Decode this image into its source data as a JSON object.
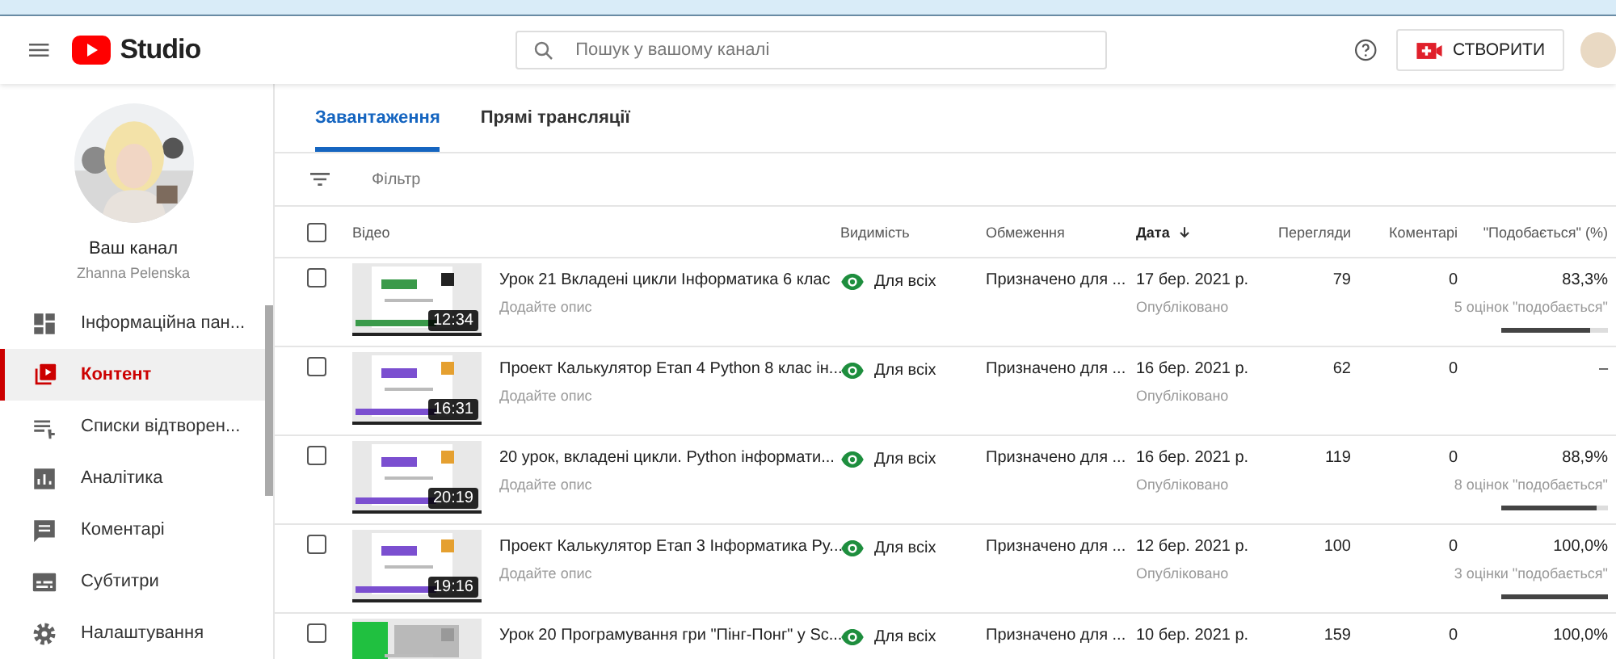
{
  "header": {
    "logo_text": "Studio",
    "search": {
      "placeholder": "Пошук у вашому каналі"
    },
    "create_button": "СТВОРИТИ"
  },
  "sidebar": {
    "channel_title": "Ваш канал",
    "channel_name": "Zhanna Pelenska",
    "items": [
      {
        "label": "Інформаційна пан...",
        "selected": false
      },
      {
        "label": "Контент",
        "selected": true
      },
      {
        "label": "Списки відтворен...",
        "selected": false
      },
      {
        "label": "Аналітика",
        "selected": false
      },
      {
        "label": "Коментарі",
        "selected": false
      },
      {
        "label": "Субтитри",
        "selected": false
      },
      {
        "label": "Налаштування",
        "selected": false
      }
    ]
  },
  "tabs": [
    {
      "label": "Завантаження",
      "selected": true
    },
    {
      "label": "Прямі трансляції",
      "selected": false
    }
  ],
  "filter": {
    "placeholder": "Фільтр"
  },
  "table": {
    "select_all_checked": false,
    "columns": [
      {
        "label": "Відео",
        "sorted": false
      },
      {
        "label": "Видимість",
        "sorted": false
      },
      {
        "label": "Обмеження",
        "sorted": false
      },
      {
        "label": "Дата",
        "sorted": true
      },
      {
        "label": "Перегляди",
        "sorted": false
      },
      {
        "label": "Коментарі",
        "sorted": false
      },
      {
        "label": "\"Подобається\" (%)",
        "sorted": false
      }
    ],
    "rows": [
      {
        "checked": false,
        "duration": "12:34",
        "title": "Урок 21 Вкладені цикли Інформатика 6 клас",
        "description": "Додайте опис",
        "visibility": "Для всіх",
        "restrictions": "Призначено для ...",
        "date": "17 бер. 2021 р.",
        "status": "Опубліковано",
        "views": "79",
        "comments": "0",
        "likes": "83,3%",
        "likes_count": "5 оцінок \"подобається\"",
        "level": 0.833
      },
      {
        "checked": false,
        "duration": "16:31",
        "title": "Проект Калькулятор Етап 4 Python 8 клас ін...",
        "description": "Додайте опис",
        "visibility": "Для всіх",
        "restrictions": "Призначено для ...",
        "date": "16 бер. 2021 р.",
        "status": "Опубліковано",
        "views": "62",
        "comments": "0",
        "likes": "–"
      },
      {
        "checked": false,
        "duration": "20:19",
        "title": "20 урок, вкладені цикли. Python інформати...",
        "description": "Додайте опис",
        "visibility": "Для всіх",
        "restrictions": "Призначено для ...",
        "date": "16 бер. 2021 р.",
        "status": "Опубліковано",
        "views": "119",
        "comments": "0",
        "likes": "88,9%",
        "likes_count": "8 оцінок \"подобається\"",
        "level": 0.889
      },
      {
        "checked": false,
        "duration": "19:16",
        "title": "Проект Калькулятор Етап 3 Інформатика Py...",
        "description": "Додайте опис",
        "visibility": "Для всіх",
        "restrictions": "Призначено для ...",
        "date": "12 бер. 2021 р.",
        "status": "Опубліковано",
        "views": "100",
        "comments": "0",
        "likes": "100,0%",
        "likes_count": "3 оцінки \"подобається\"",
        "level": 1.0
      },
      {
        "checked": false,
        "title": "Урок 20 Програмування гри \"Пінг-Понг\" у Sc...",
        "visibility": "Для всіх",
        "restrictions": "Призначено для ...",
        "date": "10 бер. 2021 р.",
        "views": "159",
        "comments": "0",
        "likes": "100,0%"
      }
    ]
  }
}
